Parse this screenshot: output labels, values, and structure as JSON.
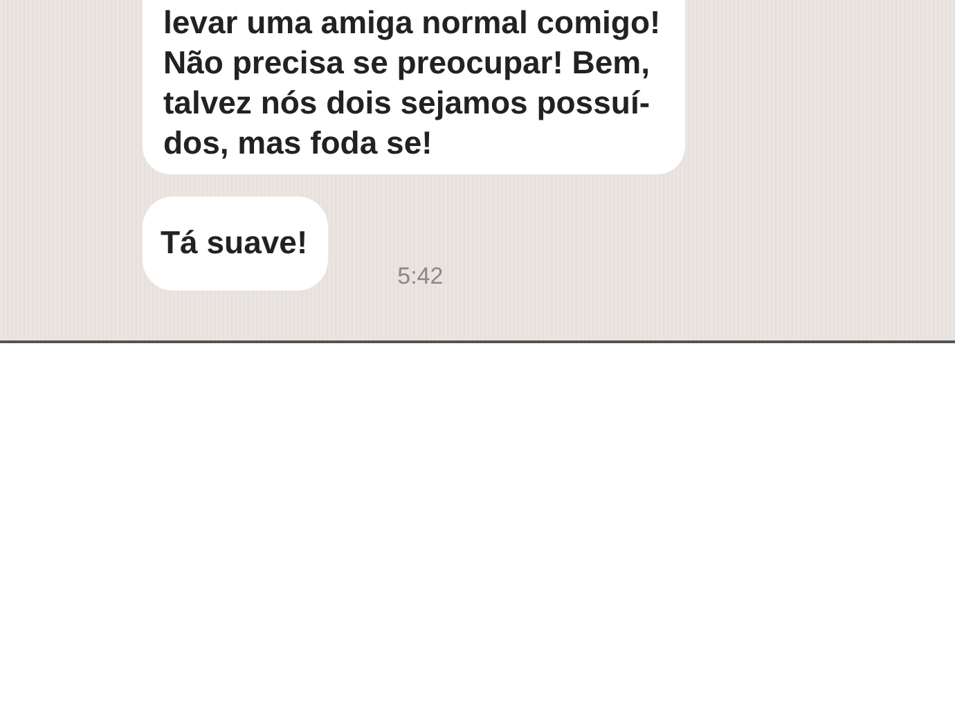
{
  "messages": [
    {
      "text": "levar uma amiga normal comigo!\nNão precisa se preocupar! Bem,\ntalvez nós dois sejamos possuí-\ndos, mas foda se!"
    },
    {
      "text": "Tá suave!",
      "time": "5:42"
    }
  ]
}
